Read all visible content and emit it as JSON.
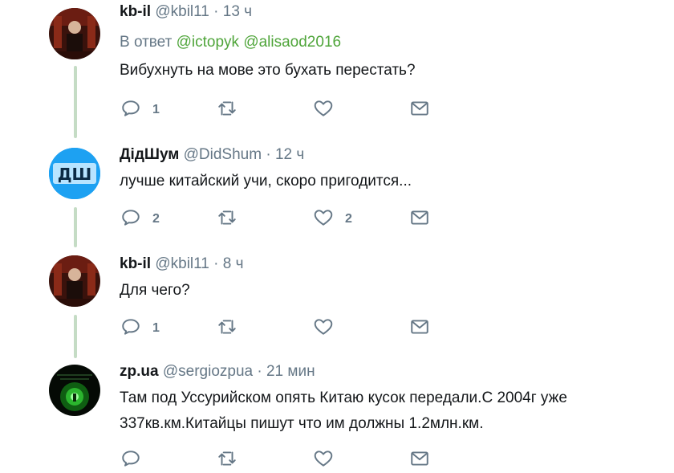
{
  "tweets": [
    {
      "name": "kb-il",
      "handle": "@kbil11",
      "sep": "·",
      "time": "13 ч",
      "reply_prefix": "В ответ",
      "mentions": [
        "@ictopyk",
        "@alisaod2016"
      ],
      "text_lines": [
        "Вибухнуть на мове это бухать перестать?"
      ],
      "reply_count": "1",
      "retweet_count": "",
      "like_count": ""
    },
    {
      "name": "ДідШум",
      "handle": "@DidShum",
      "sep": "·",
      "time": "12 ч",
      "avatar_text": "ДШ",
      "text_lines": [
        "лучше китайский учи, скоро пригодится..."
      ],
      "reply_count": "2",
      "retweet_count": "",
      "like_count": "2"
    },
    {
      "name": "kb-il",
      "handle": "@kbil11",
      "sep": "·",
      "time": "8 ч",
      "text_lines": [
        "Для чего?"
      ],
      "reply_count": "1",
      "retweet_count": "",
      "like_count": ""
    },
    {
      "name": "zp.ua",
      "handle": "@sergiozpua",
      "sep": "·",
      "time": "21 мин",
      "text_lines": [
        "Там под Уссурийском опять Китаю кусок передали.С 2004г уже",
        "337кв.км.Китайцы пишут что им должны 1.2млн.км."
      ]
    }
  ],
  "colors": {
    "mention": "#4fa53a",
    "thread_line": "#c5dcc5",
    "secondary": "#657786",
    "didshum_avatar_bg": "#1da1f2"
  },
  "icons": [
    "reply-icon",
    "retweet-icon",
    "like-icon",
    "message-icon"
  ]
}
